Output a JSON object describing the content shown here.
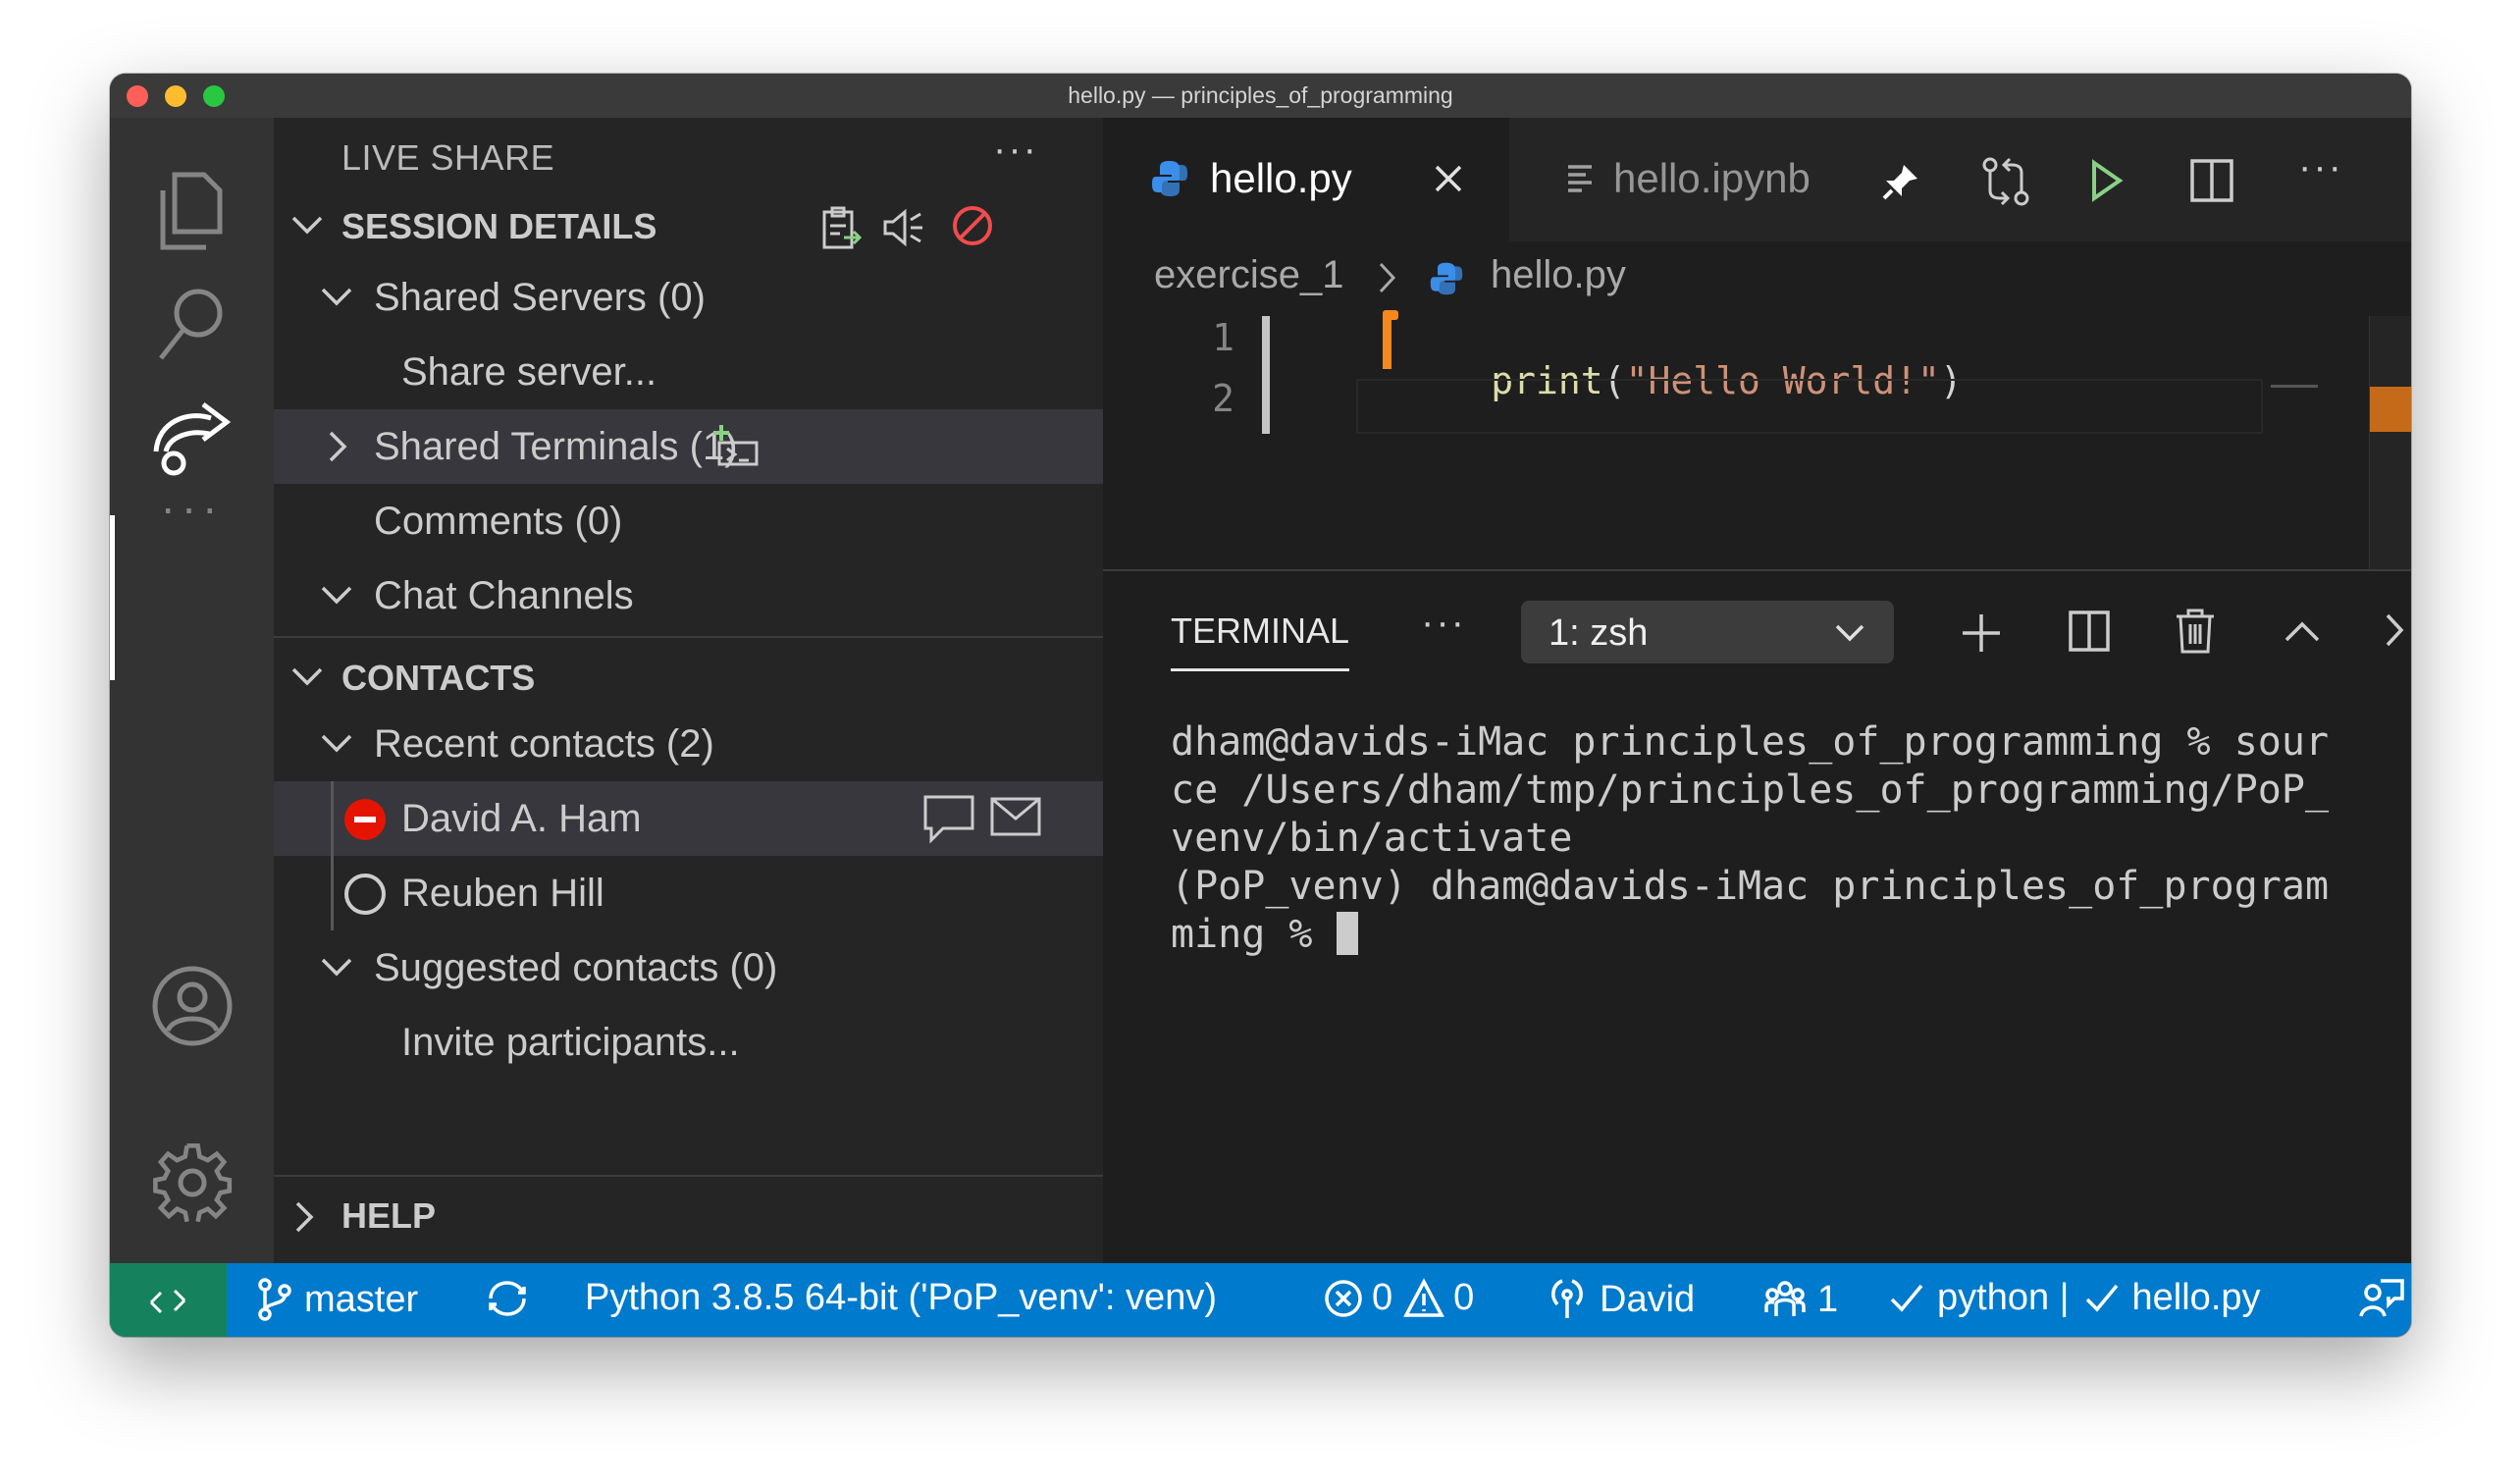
{
  "window": {
    "title": "hello.py — principles_of_programming"
  },
  "sidebar": {
    "title": "LIVE SHARE",
    "more": "···",
    "session_details": {
      "header": "SESSION DETAILS",
      "items": {
        "shared_servers": "Shared Servers (0)",
        "share_server": "Share server...",
        "shared_terminals": "Shared Terminals (1)",
        "comments": "Comments (0)",
        "chat_channels": "Chat Channels"
      }
    },
    "contacts": {
      "header": "CONTACTS",
      "recent": "Recent contacts (2)",
      "contact_1": "David A. Ham",
      "contact_2": "Reuben Hill",
      "suggested": "Suggested contacts (0)",
      "invite": "Invite participants..."
    },
    "help": {
      "header": "HELP"
    }
  },
  "editor": {
    "tabs": [
      {
        "label": "hello.py",
        "active": true
      },
      {
        "label": "hello.ipynb",
        "active": false
      }
    ],
    "breadcrumb": {
      "folder": "exercise_1",
      "file": "hello.py"
    },
    "lines": [
      {
        "number": "1",
        "fn": "print",
        "open": "(",
        "string": "\"Hello World!\"",
        "close": ")"
      },
      {
        "number": "2"
      }
    ]
  },
  "terminal": {
    "tab": "TERMINAL",
    "more": "···",
    "selected_shell": "1: zsh",
    "output": [
      "dham@davids-iMac principles_of_programming % sour",
      "ce /Users/dham/tmp/principles_of_programming/PoP_",
      "venv/bin/activate",
      "(PoP_venv) dham@davids-iMac principles_of_program",
      "ming % "
    ]
  },
  "statusbar": {
    "branch": "master",
    "interpreter": "Python 3.8.5 64-bit ('PoP_venv': venv)",
    "errors": "0",
    "warnings": "0",
    "live_share_user": "David",
    "participants": "1",
    "check_python": "python |",
    "check_file": "hello.py"
  },
  "colors": {
    "statusbar": "#007acc",
    "remote": "#16825d",
    "activity_bar": "#333333",
    "sidebar": "#252526",
    "editor": "#1e1e1e",
    "run_green": "#89d185",
    "stop_red": "#f14c4c",
    "string": "#ce9178",
    "function": "#dcdcaa"
  }
}
